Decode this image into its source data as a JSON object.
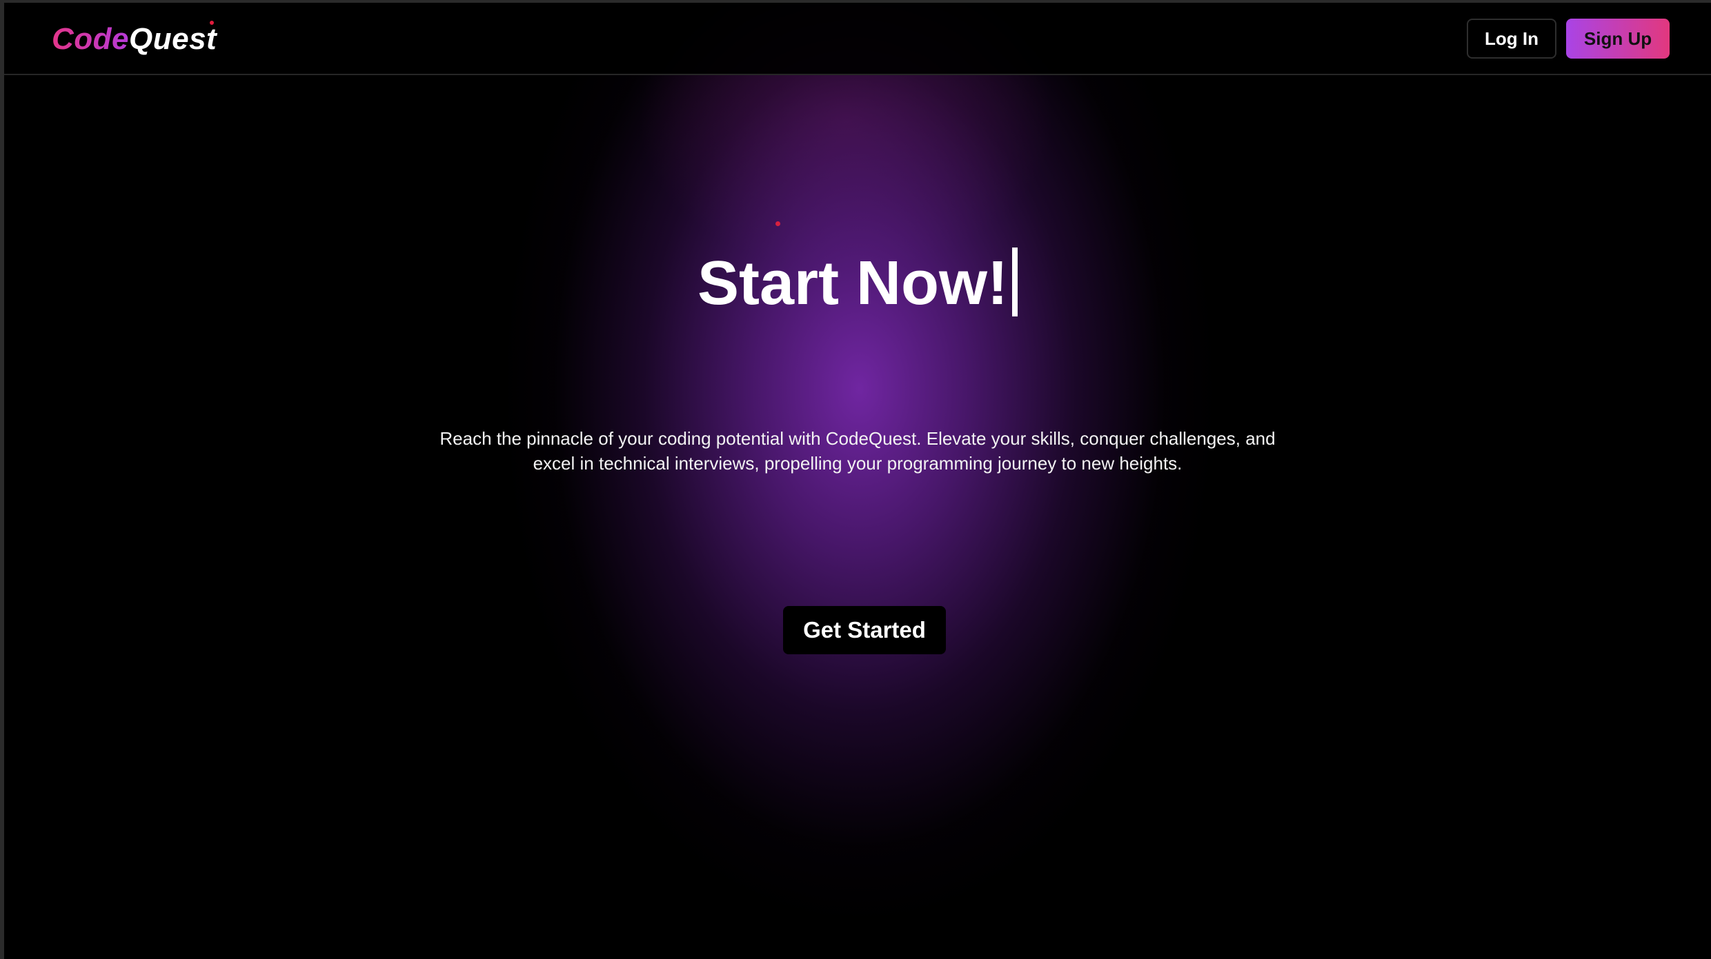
{
  "navbar": {
    "logo_part1": "Code",
    "logo_part2": "Quest",
    "login_label": "Log In",
    "signup_label": "Sign Up"
  },
  "hero": {
    "headline": "Start Now!",
    "description": "Reach the pinnacle of your coding potential with CodeQuest. Elevate your skills, conquer challenges, and excel in technical interviews, propelling your programming journey to new heights.",
    "cta_label": "Get Started"
  },
  "colors": {
    "background": "#000000",
    "accent_pink": "#e2387e",
    "accent_purple": "#a944e6",
    "glow_purple": "#7628aa",
    "dot_red": "#d8203f"
  }
}
